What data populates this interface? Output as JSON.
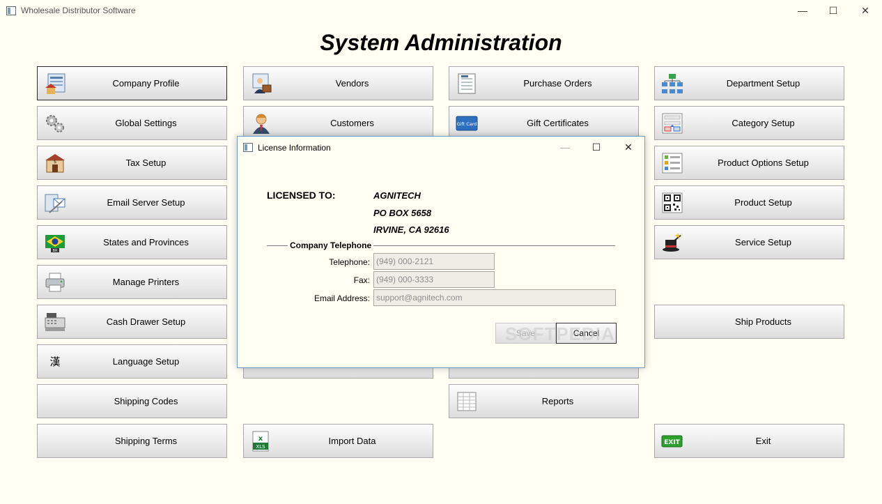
{
  "window": {
    "title": "Wholesale Distributor Software",
    "controls": {
      "minimize": "—",
      "maximize": "☐",
      "close": "✕"
    }
  },
  "page_title": "System Administration",
  "buttons": [
    {
      "label": "Company Profile",
      "icon": "company-profile-icon",
      "active": true
    },
    {
      "label": "Global Settings",
      "icon": "gears-icon"
    },
    {
      "label": "Tax Setup",
      "icon": "tax-store-icon"
    },
    {
      "label": "Email Server Setup",
      "icon": "email-server-icon"
    },
    {
      "label": "States and Provinces",
      "icon": "flag-icon"
    },
    {
      "label": "Manage Printers",
      "icon": "printer-icon"
    },
    {
      "label": "Cash Drawer Setup",
      "icon": "cash-register-icon"
    },
    {
      "label": "Language Setup",
      "icon": "kanji-icon",
      "glyph": "漢"
    },
    {
      "label": "Shipping Codes",
      "icon": ""
    },
    {
      "label": "Shipping Terms",
      "icon": ""
    },
    {
      "label": "Vendors",
      "icon": "vendor-icon"
    },
    {
      "label": "Customers",
      "icon": "customer-icon"
    },
    {
      "label": "Import Data",
      "icon": "xls-icon",
      "glyph": "XLS"
    },
    {
      "label": "Purchase Orders",
      "icon": "purchase-order-icon"
    },
    {
      "label": "Gift Certificates",
      "icon": "gift-card-icon",
      "glyph": "Gift Card"
    },
    {
      "label": "Reports",
      "icon": "report-icon"
    },
    {
      "label": "Department Setup",
      "icon": "org-chart-icon"
    },
    {
      "label": "Category Setup",
      "icon": "category-icon"
    },
    {
      "label": "Product Options Setup",
      "icon": "product-options-icon"
    },
    {
      "label": "Product Setup",
      "icon": "qr-code-icon"
    },
    {
      "label": "Service Setup",
      "icon": "magic-hat-icon"
    },
    {
      "label": "Ship Products",
      "icon": ""
    },
    {
      "label": "Exit",
      "icon": "exit-icon",
      "glyph": "EXIT"
    }
  ],
  "dialog": {
    "title": "License Information",
    "controls": {
      "minimize": "—",
      "maximize": "☐",
      "close": "✕"
    },
    "licensed_to_label": "LICENSED TO:",
    "address_lines": [
      "AGNITECH",
      "PO BOX 5658",
      "IRVINE, CA 92616"
    ],
    "section_label": "Company Telephone",
    "fields": {
      "telephone": {
        "label": "Telephone:",
        "value": "(949) 000-2121"
      },
      "fax": {
        "label": "Fax:",
        "value": "(949) 000-3333"
      },
      "email": {
        "label": "Email Address:",
        "value": "support@agnitech.com"
      }
    },
    "save_label": "Save",
    "cancel_label": "Cancel",
    "watermark": "SOFTPEDIA"
  },
  "colors": {
    "background": "#fffff4",
    "dialog_border": "#6d9cc9"
  }
}
